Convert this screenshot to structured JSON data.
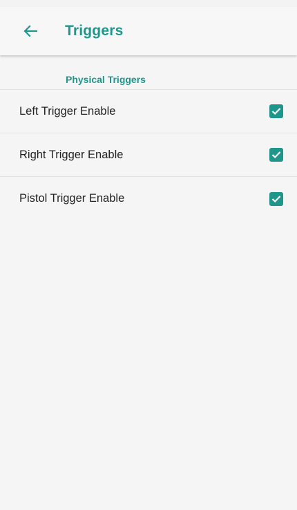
{
  "app_bar": {
    "back_icon": "arrow-left-icon",
    "title": "Triggers"
  },
  "section": {
    "title": "Physical Triggers"
  },
  "preferences": [
    {
      "label": "Left Trigger Enable",
      "checked": true
    },
    {
      "label": "Right Trigger Enable",
      "checked": true
    },
    {
      "label": "Pistol Trigger Enable",
      "checked": true
    }
  ],
  "colors": {
    "accent": "#1f968b",
    "text": "#222222",
    "background": "#f5f5f5"
  }
}
